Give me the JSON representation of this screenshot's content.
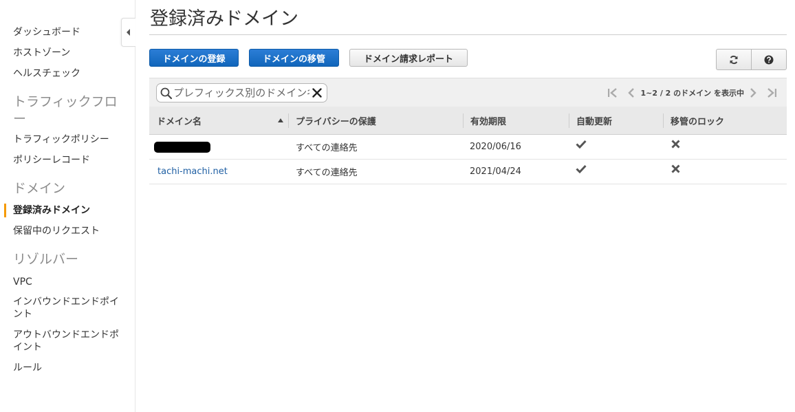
{
  "sidebar": {
    "items": [
      {
        "label": "ダッシュボード"
      },
      {
        "label": "ホストゾーン"
      },
      {
        "label": "ヘルスチェック"
      }
    ],
    "sections": [
      {
        "title": "トラフィックフロー",
        "items": [
          {
            "label": "トラフィックポリシー"
          },
          {
            "label": "ポリシーレコード"
          }
        ]
      },
      {
        "title": "ドメイン",
        "items": [
          {
            "label": "登録済みドメイン",
            "active": true
          },
          {
            "label": "保留中のリクエスト"
          }
        ]
      },
      {
        "title": "リゾルバー",
        "items": [
          {
            "label": "VPC"
          },
          {
            "label": "インバウンドエンドポイント"
          },
          {
            "label": "アウトバウンドエンドポイント"
          },
          {
            "label": "ルール"
          }
        ]
      }
    ]
  },
  "page": {
    "title": "登録済みドメイン"
  },
  "toolbar": {
    "register_label": "ドメインの登録",
    "transfer_label": "ドメインの移管",
    "billing_label": "ドメイン請求レポート"
  },
  "search": {
    "placeholder": "プレフィックス別のドメイン名"
  },
  "pager": {
    "text": "1~2 / 2 のドメイン を表示中"
  },
  "table": {
    "columns": [
      "ドメイン名",
      "プライバシーの保護",
      "有効期限",
      "自動更新",
      "移管のロック"
    ],
    "rows": [
      {
        "name": "",
        "redacted": true,
        "privacy": "すべての連絡先",
        "expires": "2020/06/16",
        "auto_renew": true,
        "transfer_lock": false
      },
      {
        "name": "tachi-machi.net",
        "redacted": false,
        "privacy": "すべての連絡先",
        "expires": "2021/04/24",
        "auto_renew": true,
        "transfer_lock": false
      }
    ]
  },
  "colors": {
    "primary": "#1a6fc8",
    "active_marker": "#f59a00",
    "link": "#1f5fa3"
  }
}
